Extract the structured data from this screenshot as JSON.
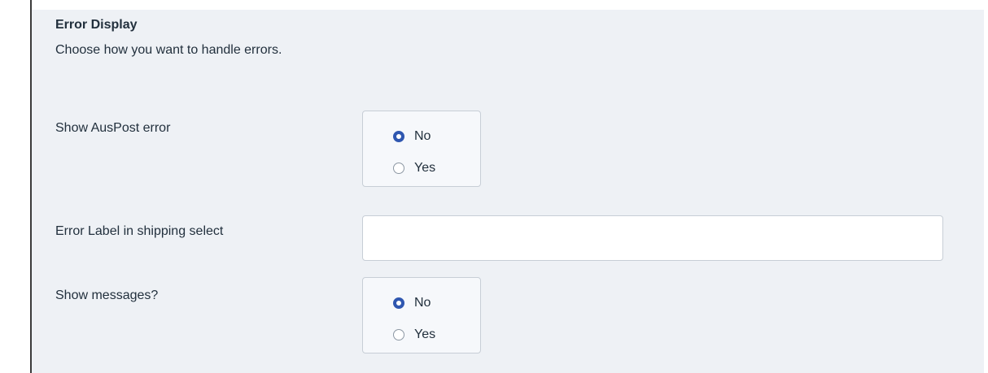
{
  "section": {
    "title": "Error Display",
    "description": "Choose how you want to handle errors."
  },
  "fields": {
    "show_auspost_error": {
      "label": "Show AusPost error",
      "options": [
        "No",
        "Yes"
      ],
      "selected": "No"
    },
    "error_label": {
      "label": "Error Label in shipping select",
      "value": "",
      "placeholder": ""
    },
    "show_messages": {
      "label": "Show messages?",
      "options": [
        "No",
        "Yes"
      ],
      "selected": "No"
    }
  },
  "colors": {
    "panel_background": "#eef1f5",
    "radio_accent": "#2f57b0",
    "border": "#c7ced6"
  }
}
